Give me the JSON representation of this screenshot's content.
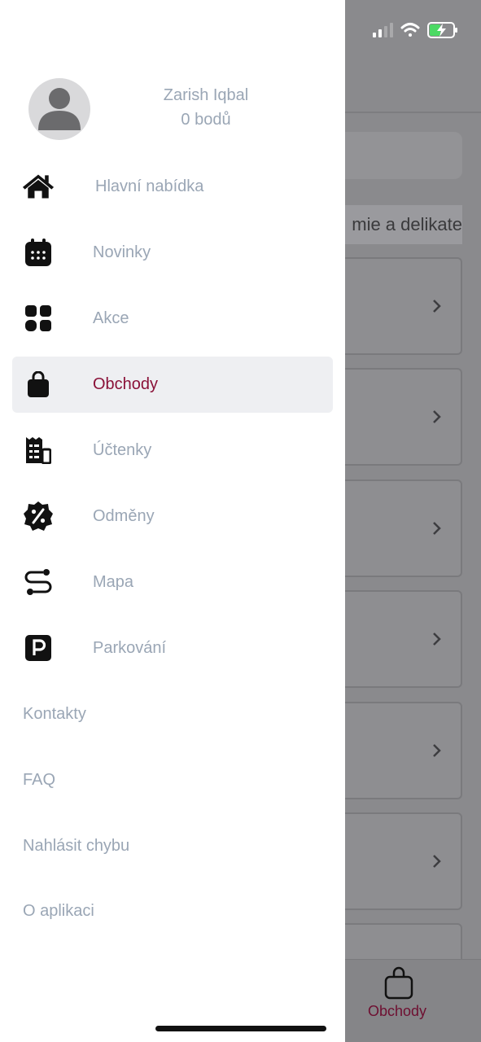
{
  "user": {
    "name": "Zarish Iqbal",
    "points": "0 bodů"
  },
  "menu": {
    "items": [
      {
        "label": "Hlavní nabídka",
        "icon": "home-icon"
      },
      {
        "label": "Novinky",
        "icon": "calendar-icon"
      },
      {
        "label": "Akce",
        "icon": "grid-icon"
      },
      {
        "label": "Obchody",
        "icon": "shopping-bag-icon",
        "active": true
      },
      {
        "label": "Účtenky",
        "icon": "receipt-icon"
      },
      {
        "label": "Odměny",
        "icon": "discount-badge-icon"
      },
      {
        "label": "Mapa",
        "icon": "route-icon"
      },
      {
        "label": "Parkování",
        "icon": "parking-icon"
      }
    ],
    "links": [
      "Kontakty",
      "FAQ",
      "Nahlásit chybu",
      "O aplikaci"
    ]
  },
  "background": {
    "category_fragment": "mie a delikate",
    "tab_label": "Obchody"
  },
  "colors": {
    "accent": "#8a1138",
    "muted_text": "#9aa6b5",
    "active_bg": "#eeeff2",
    "overlay": "#8a8a8d"
  }
}
